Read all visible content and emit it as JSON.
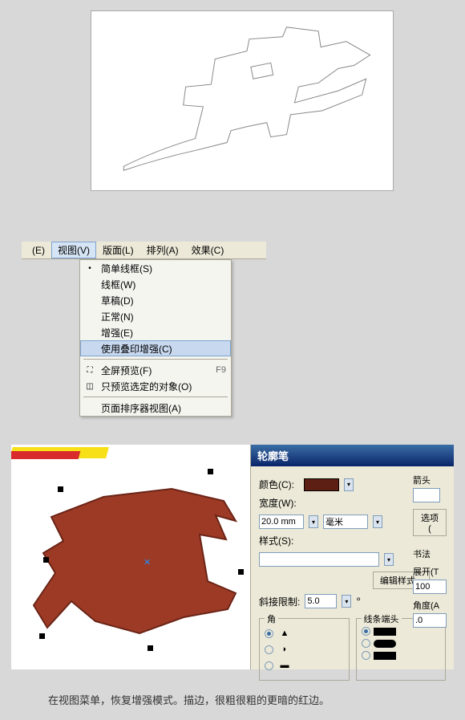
{
  "menubar": {
    "items_left": "(E)",
    "view": "视图(V)",
    "layout": "版面(L)",
    "arrange": "排列(A)",
    "effects": "效果(C)"
  },
  "dropdown": {
    "simple_wireframe": "简单线框(S)",
    "wireframe": "线框(W)",
    "draft": "草稿(D)",
    "normal": "正常(N)",
    "enhanced": "增强(E)",
    "overprint_enhanced": "使用叠印增强(C)",
    "fullscreen": "全屏预览(F)",
    "fullscreen_key": "F9",
    "preview_selected": "只预览选定的对象(O)",
    "page_sorter": "页面排序器视图(A)"
  },
  "behind_label": "使用叠",
  "outline_pen": {
    "title": "轮廓笔",
    "color_label": "颜色(C):",
    "width_label": "宽度(W):",
    "width_value": "20.0 mm",
    "width_unit": "毫米",
    "style_label": "样式(S):",
    "edit_style": "编辑样式...",
    "miter_label": "斜接限制:",
    "miter_value": "5.0",
    "corners_label": "角",
    "linecaps_label": "线条端头",
    "arrow_label": "箭头",
    "options_btn": "选项(",
    "calligraphy": "书法",
    "stretch": "展开(T",
    "stretch_value": "100",
    "angle": "角度(A",
    "angle_value": ".0"
  },
  "caption": "在视图菜单，恢复增强模式。描边，很粗很粗的更暗的红边。"
}
